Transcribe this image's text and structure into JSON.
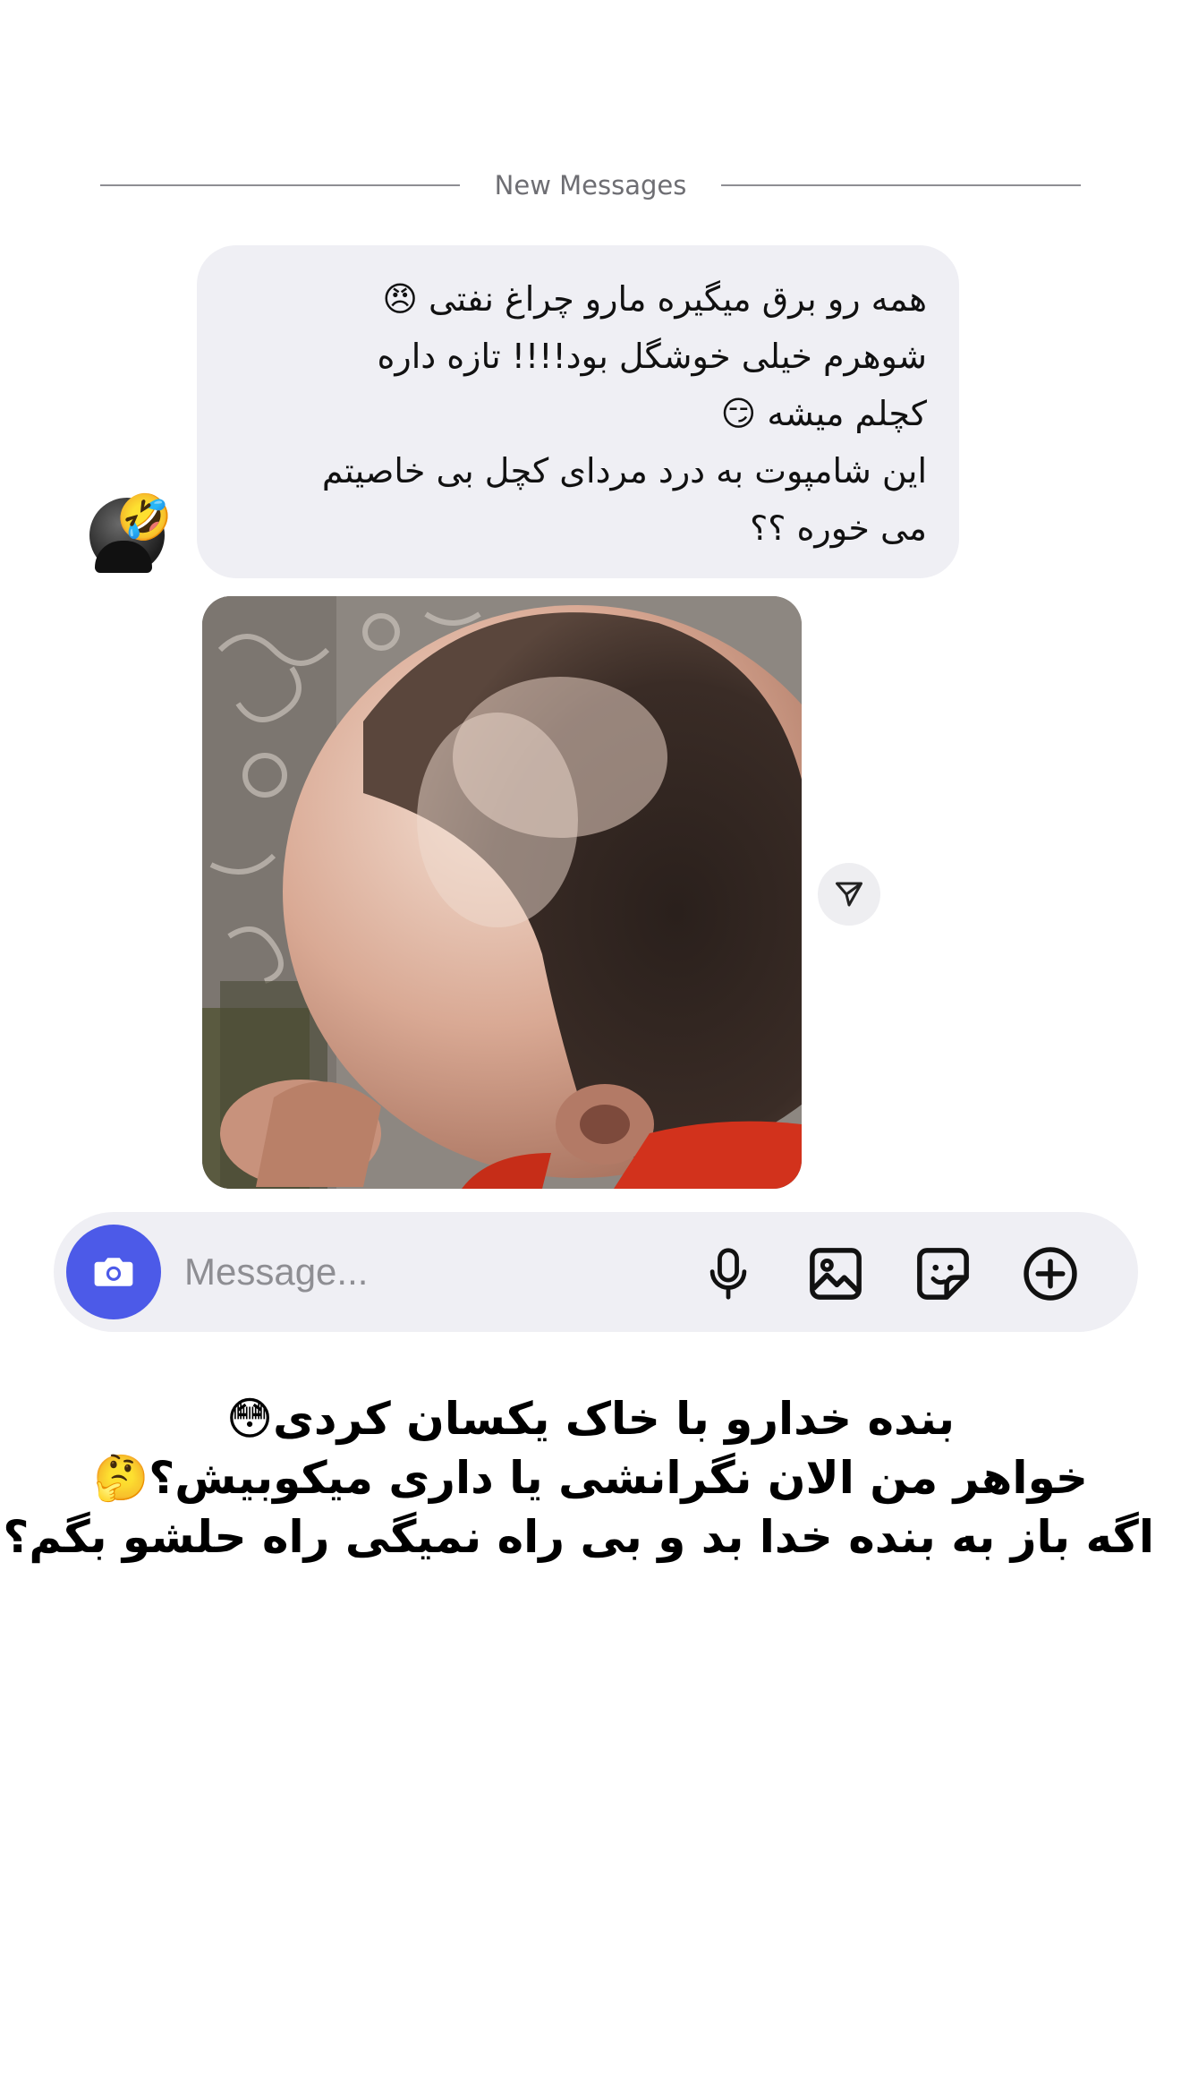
{
  "divider": {
    "label": "New Messages"
  },
  "message": {
    "lines": [
      "همه رو برق میگیره مارو چراغ نفتی 😠",
      "شوهرم خیلی خوشگل بود!!!!  تازه داره",
      "کچلم میشه 😏",
      "این شامپوت به درد مردای کچل بی خاصیتم",
      "می خوره ؟؟"
    ],
    "avatar_badge": "🤣"
  },
  "composer": {
    "placeholder": "Message..."
  },
  "icons": {
    "camera": "camera-icon",
    "microphone": "microphone-icon",
    "gallery": "gallery-icon",
    "sticker": "sticker-icon",
    "add": "plus-icon",
    "share": "send-icon"
  },
  "caption": {
    "lines": [
      "بنده خدارو با خاک یکسان کردی😳",
      "خواهر من الان نگرانشی یا داری میکوبیش؟🤔",
      "اگه باز به بنده خدا بد و بی راه نمیگی راه حلشو بگم؟😐"
    ]
  },
  "colors": {
    "accent": "#4c5ae8",
    "bubble": "#efeff4",
    "composer": "#efeff4"
  }
}
